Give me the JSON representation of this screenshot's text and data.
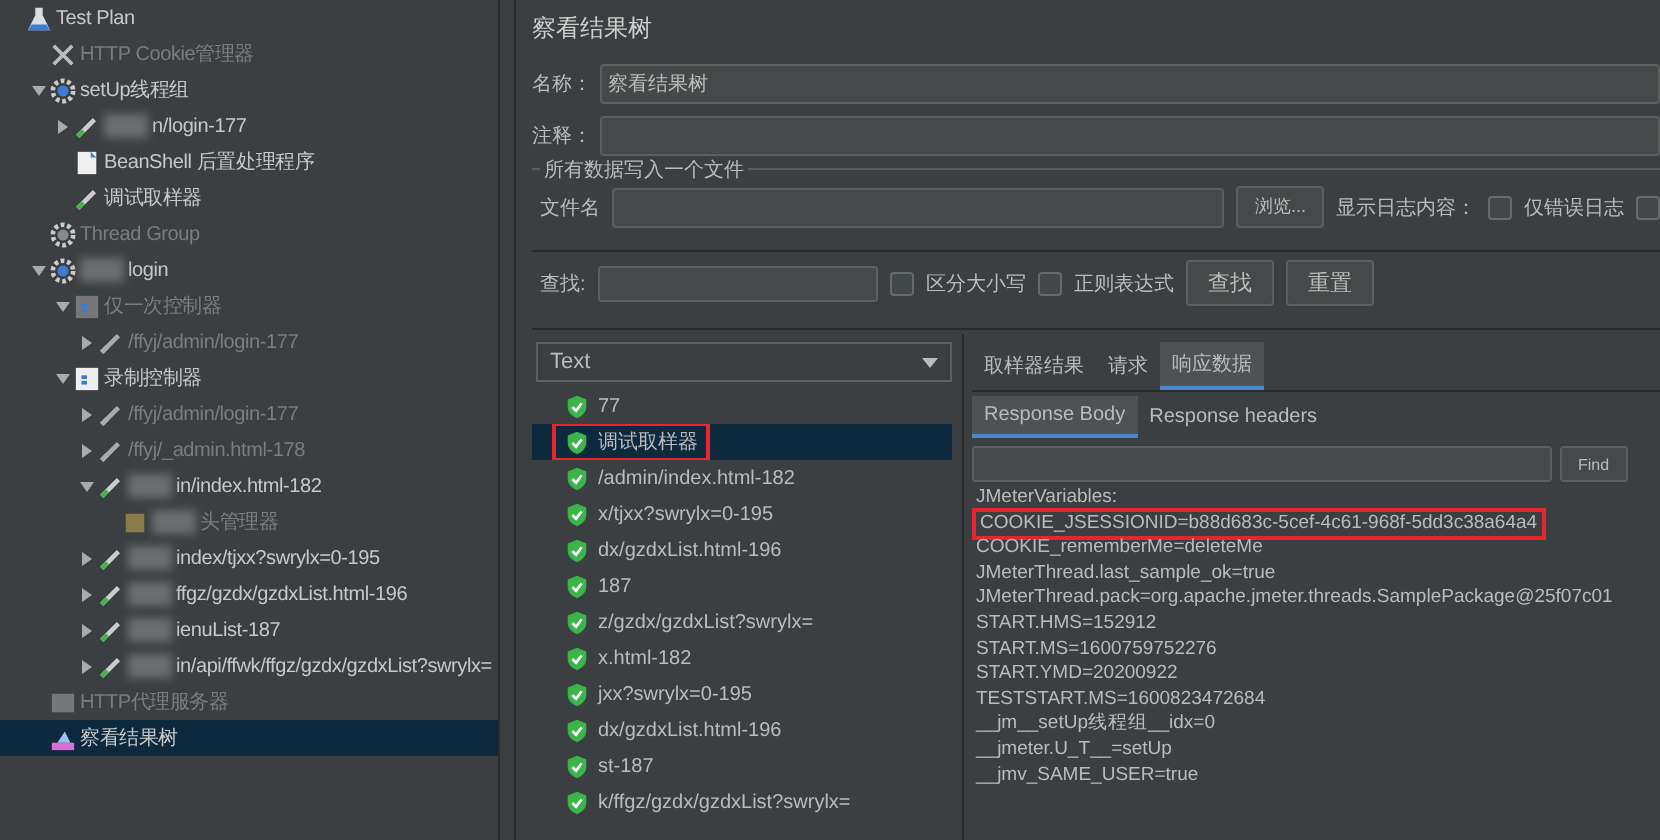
{
  "tree": [
    {
      "label": "Test Plan",
      "kind": "testplan",
      "disabled": false,
      "selected": false,
      "children": [
        {
          "label": "HTTP Cookie管理器",
          "kind": "tool",
          "disabled": true,
          "selected": false
        },
        {
          "label": "setUp线程组",
          "kind": "gear",
          "disabled": false,
          "selected": false,
          "expanded": true,
          "children": [
            {
              "label": "n/login-177",
              "kind": "sampler",
              "disabled": false,
              "selected": false,
              "expanded": false,
              "redacted": true
            },
            {
              "label": "BeanShell 后置处理程序",
              "kind": "script",
              "disabled": false,
              "selected": false
            },
            {
              "label": "调试取样器",
              "kind": "sampler",
              "disabled": false,
              "selected": false
            }
          ]
        },
        {
          "label": "Thread Group",
          "kind": "gear",
          "disabled": true,
          "selected": false
        },
        {
          "label": "login",
          "kind": "gear",
          "disabled": false,
          "selected": false,
          "expanded": true,
          "redacted": true,
          "children": [
            {
              "label": "仅一次控制器",
              "kind": "controller",
              "disabled": true,
              "selected": false,
              "expanded": true,
              "children": [
                {
                  "label": "/ffyj/admin/login-177",
                  "kind": "sampler",
                  "disabled": true,
                  "selected": false,
                  "expanded": false
                }
              ]
            },
            {
              "label": "录制控制器",
              "kind": "controller",
              "disabled": false,
              "selected": false,
              "expanded": true,
              "children": [
                {
                  "label": "/ffyj/admin/login-177",
                  "kind": "sampler",
                  "disabled": true,
                  "selected": false,
                  "expanded": false
                },
                {
                  "label": "/ffyj/_admin.html-178",
                  "kind": "sampler",
                  "disabled": true,
                  "selected": false,
                  "expanded": false
                },
                {
                  "label": "in/index.html-182",
                  "kind": "sampler",
                  "disabled": false,
                  "selected": false,
                  "expanded": true,
                  "redacted": true,
                  "children": [
                    {
                      "label": "头管理器",
                      "kind": "header",
                      "disabled": true,
                      "selected": false,
                      "redacted": true
                    }
                  ]
                },
                {
                  "label": "index/tjxx?swrylx=0-195",
                  "kind": "sampler",
                  "disabled": false,
                  "selected": false,
                  "expanded": false,
                  "redacted": true
                },
                {
                  "label": "ffgz/gzdx/gzdxList.html-196",
                  "kind": "sampler",
                  "disabled": false,
                  "selected": false,
                  "expanded": false,
                  "redacted": true
                },
                {
                  "label": "ienuList-187",
                  "kind": "sampler",
                  "disabled": false,
                  "selected": false,
                  "expanded": false,
                  "redacted": true
                },
                {
                  "label": "in/api/ffwk/ffgz/gzdx/gzdxList?swrylx=",
                  "kind": "sampler",
                  "disabled": false,
                  "selected": false,
                  "expanded": false,
                  "redacted": true
                }
              ]
            }
          ]
        },
        {
          "label": "HTTP代理服务器",
          "kind": "proxy",
          "disabled": true,
          "selected": false
        },
        {
          "label": "察看结果树",
          "kind": "listener",
          "disabled": false,
          "selected": true
        }
      ]
    }
  ],
  "panel": {
    "title": "察看结果树",
    "name_label": "名称：",
    "name_value": "察看结果树",
    "comment_label": "注释：",
    "file_group": "所有数据写入一个文件",
    "file_label": "文件名",
    "browse_button": "浏览...",
    "log_label": "显示日志内容：",
    "log_options": [
      {
        "label": "仅错误日志",
        "checked": false
      },
      {
        "checked": false
      }
    ],
    "search_label": "查找:",
    "search_options": [
      {
        "label": "区分大小写",
        "checked": false
      },
      {
        "label": "正则表达式",
        "checked": false
      }
    ],
    "search_button": "查找",
    "reset_button": "重置"
  },
  "renderer": "Text",
  "results": [
    {
      "label": "77",
      "selected": false,
      "highlighted": false
    },
    {
      "label": "调试取样器",
      "selected": true,
      "highlighted": true
    },
    {
      "label": "/admin/index.html-182",
      "selected": false,
      "highlighted": false
    },
    {
      "label": "x/tjxx?swrylx=0-195",
      "selected": false,
      "highlighted": false
    },
    {
      "label": "dx/gzdxList.html-196",
      "selected": false,
      "highlighted": false
    },
    {
      "label": "187",
      "selected": false,
      "highlighted": false
    },
    {
      "label": "z/gzdx/gzdxList?swrylx=",
      "selected": false,
      "highlighted": false
    },
    {
      "label": "x.html-182",
      "selected": false,
      "highlighted": false
    },
    {
      "label": "jxx?swrylx=0-195",
      "selected": false,
      "highlighted": false
    },
    {
      "label": "dx/gzdxList.html-196",
      "selected": false,
      "highlighted": false
    },
    {
      "label": "st-187",
      "selected": false,
      "highlighted": false
    },
    {
      "label": "k/ffgz/gzdx/gzdxList?swrylx=",
      "selected": false,
      "highlighted": false
    }
  ],
  "tabs": [
    {
      "label": "取样器结果",
      "selected": false
    },
    {
      "label": "请求",
      "selected": false
    },
    {
      "label": "响应数据",
      "selected": true
    }
  ],
  "subtabs": [
    {
      "label": "Response Body",
      "selected": true
    },
    {
      "label": "Response headers",
      "selected": false
    }
  ],
  "find_button": "Find",
  "body_lines": [
    {
      "text": "JMeterVariables:",
      "highlighted": false
    },
    {
      "text": "COOKIE_JSESSIONID=b88d683c-5cef-4c61-968f-5dd3c38a64a4",
      "highlighted": true
    },
    {
      "text": "COOKIE_rememberMe=deleteMe",
      "highlighted": false
    },
    {
      "text": "JMeterThread.last_sample_ok=true",
      "highlighted": false
    },
    {
      "text": "JMeterThread.pack=org.apache.jmeter.threads.SamplePackage@25f07c01",
      "highlighted": false
    },
    {
      "text": "START.HMS=152912",
      "highlighted": false
    },
    {
      "text": "START.MS=1600759752276",
      "highlighted": false
    },
    {
      "text": "START.YMD=20200922",
      "highlighted": false
    },
    {
      "text": "TESTSTART.MS=1600823472684",
      "highlighted": false
    },
    {
      "text": "__jm__setUp线程组__idx=0",
      "highlighted": false
    },
    {
      "text": "__jmeter.U_T__=setUp",
      "highlighted": false
    },
    {
      "text": "__jmv_SAME_USER=true",
      "highlighted": false
    }
  ]
}
